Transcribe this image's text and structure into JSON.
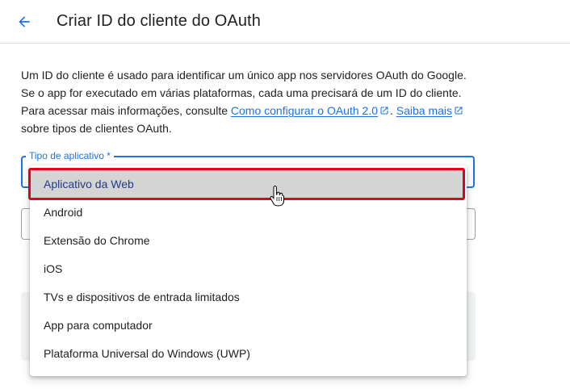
{
  "header": {
    "title": "Criar ID do cliente do OAuth"
  },
  "description": {
    "text1": "Um ID do cliente é usado para identificar um único app nos servidores OAuth do Google.",
    "text2": "Se o app for executado em várias plataformas, cada uma precisará de um ID do cliente.",
    "text3": "Para acessar mais informações, consulte",
    "link1": "Como configurar o OAuth 2.0",
    "sep": ".",
    "link2": "Saiba mais",
    "text4": "sobre tipos de clientes OAuth."
  },
  "app_type_field": {
    "label": "Tipo de aplicativo *"
  },
  "dropdown": {
    "options": [
      "Aplicativo da Web",
      "Android",
      "Extensão do Chrome",
      "iOS",
      "TVs e dispositivos de entrada limitados",
      "App para computador",
      "Plataforma Universal do Windows (UWP)"
    ],
    "selected_index": 0
  },
  "colors": {
    "accent": "#1a73e8",
    "highlight_border": "#e0001b",
    "selected_bg": "#d4d4d4"
  },
  "icons": [
    "arrow-back-icon",
    "external-link-icon",
    "hand-pointer-cursor-icon"
  ]
}
